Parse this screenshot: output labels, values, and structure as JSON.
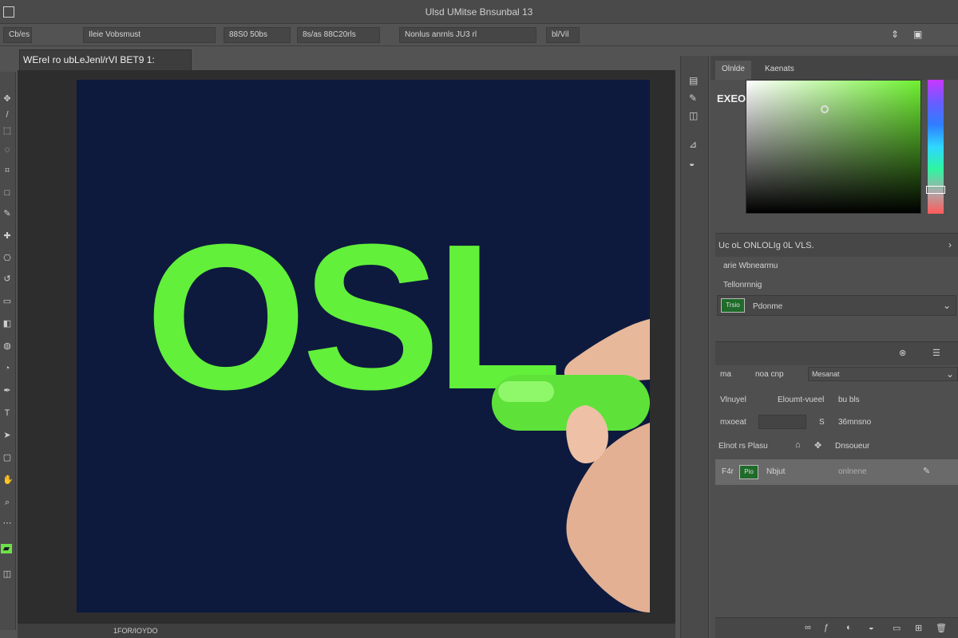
{
  "titlebar": {
    "title": "Ulsd UMitse Bnsunbal  13"
  },
  "options": [
    {
      "label": "Cb/es"
    },
    {
      "label": "Ileie  Vobsmust"
    },
    {
      "label": "88S0  50bs"
    },
    {
      "label": "8s/as   88C20rls"
    },
    {
      "label": "Nonlus   anrnls  JU3   rl"
    },
    {
      "label": "bl/Vil"
    }
  ],
  "document": {
    "tab_label": "WEreI ro  ubLeJenl/rVI BET9 1:"
  },
  "artwork": {
    "text": "OSL",
    "bg_color": "#0d1a3d",
    "text_color": "#62f03a"
  },
  "status": {
    "zoom": "1FOR/IOYDO"
  },
  "panel": {
    "tabs": [
      "Olnlde",
      "Kaenats"
    ],
    "hex_label": "EXEO",
    "props_header": "Uc oL ONLOLIg  0L VLS.",
    "props_row1": "arie Wbnearmu",
    "props_row2": "Tellonrnnig",
    "props_swatch": "Trsio",
    "props_swatch_label": "Pdonme",
    "blend_label": "ma",
    "blend_a": "noa  cnp",
    "blend_mode": "Mesanat",
    "opacity_label": "Vlnuyel",
    "opacity_val": "Eloumt-vueel",
    "opacity_pct": "bu bls",
    "fill_label": "mxoeat",
    "fill_val": "S",
    "fill_pct": "36mnsno",
    "lock_label": "Elnot   rs  Plasu",
    "lock_icons": "Dnsoueur",
    "layer_prefix": "F4r",
    "layer_thumb": "Pio",
    "layer_name": "Nbjut",
    "layer_extra": "onlnene"
  }
}
